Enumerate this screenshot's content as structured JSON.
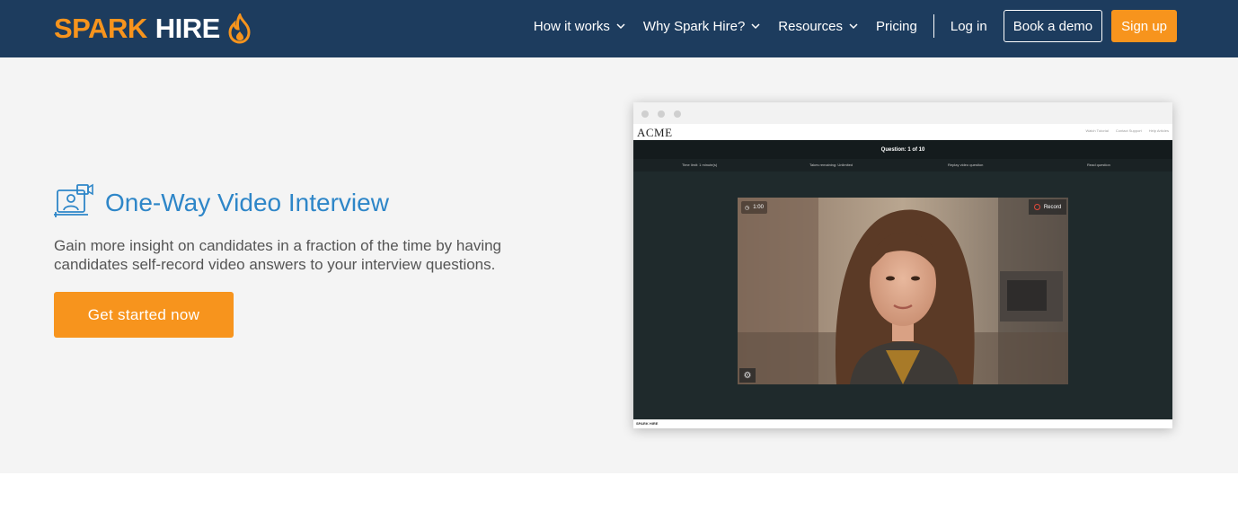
{
  "nav": {
    "logo": {
      "part1": "SPARK",
      "part2": "HIRE"
    },
    "items": [
      {
        "label": "How it works",
        "has_dropdown": true
      },
      {
        "label": "Why Spark Hire?",
        "has_dropdown": true
      },
      {
        "label": "Resources",
        "has_dropdown": true
      },
      {
        "label": "Pricing",
        "has_dropdown": false
      }
    ],
    "login": "Log in",
    "demo": "Book a demo",
    "signup": "Sign up"
  },
  "hero": {
    "icon": "video-interview-icon",
    "title": "One-Way Video Interview",
    "description": "Gain more insight on candidates in a fraction of the time by having candidates self-record video answers to your interview questions.",
    "cta": "Get started now"
  },
  "mock": {
    "brand": "ACME",
    "header_links": [
      "Watch Tutorial",
      "Contact Support",
      "Help Articles"
    ],
    "question": "Question: 1 of 10",
    "info": [
      "Time limit: 1 minute(s)",
      "Takes remaining: Unlimited",
      "Replay video question",
      "Read question"
    ],
    "timer": "1:00",
    "record": "Record",
    "footer": "SPARK HIRE"
  },
  "colors": {
    "nav_bg": "#1d3c5e",
    "accent": "#f7941d",
    "title_blue": "#2e86c8",
    "hero_bg": "#f4f4f4"
  }
}
